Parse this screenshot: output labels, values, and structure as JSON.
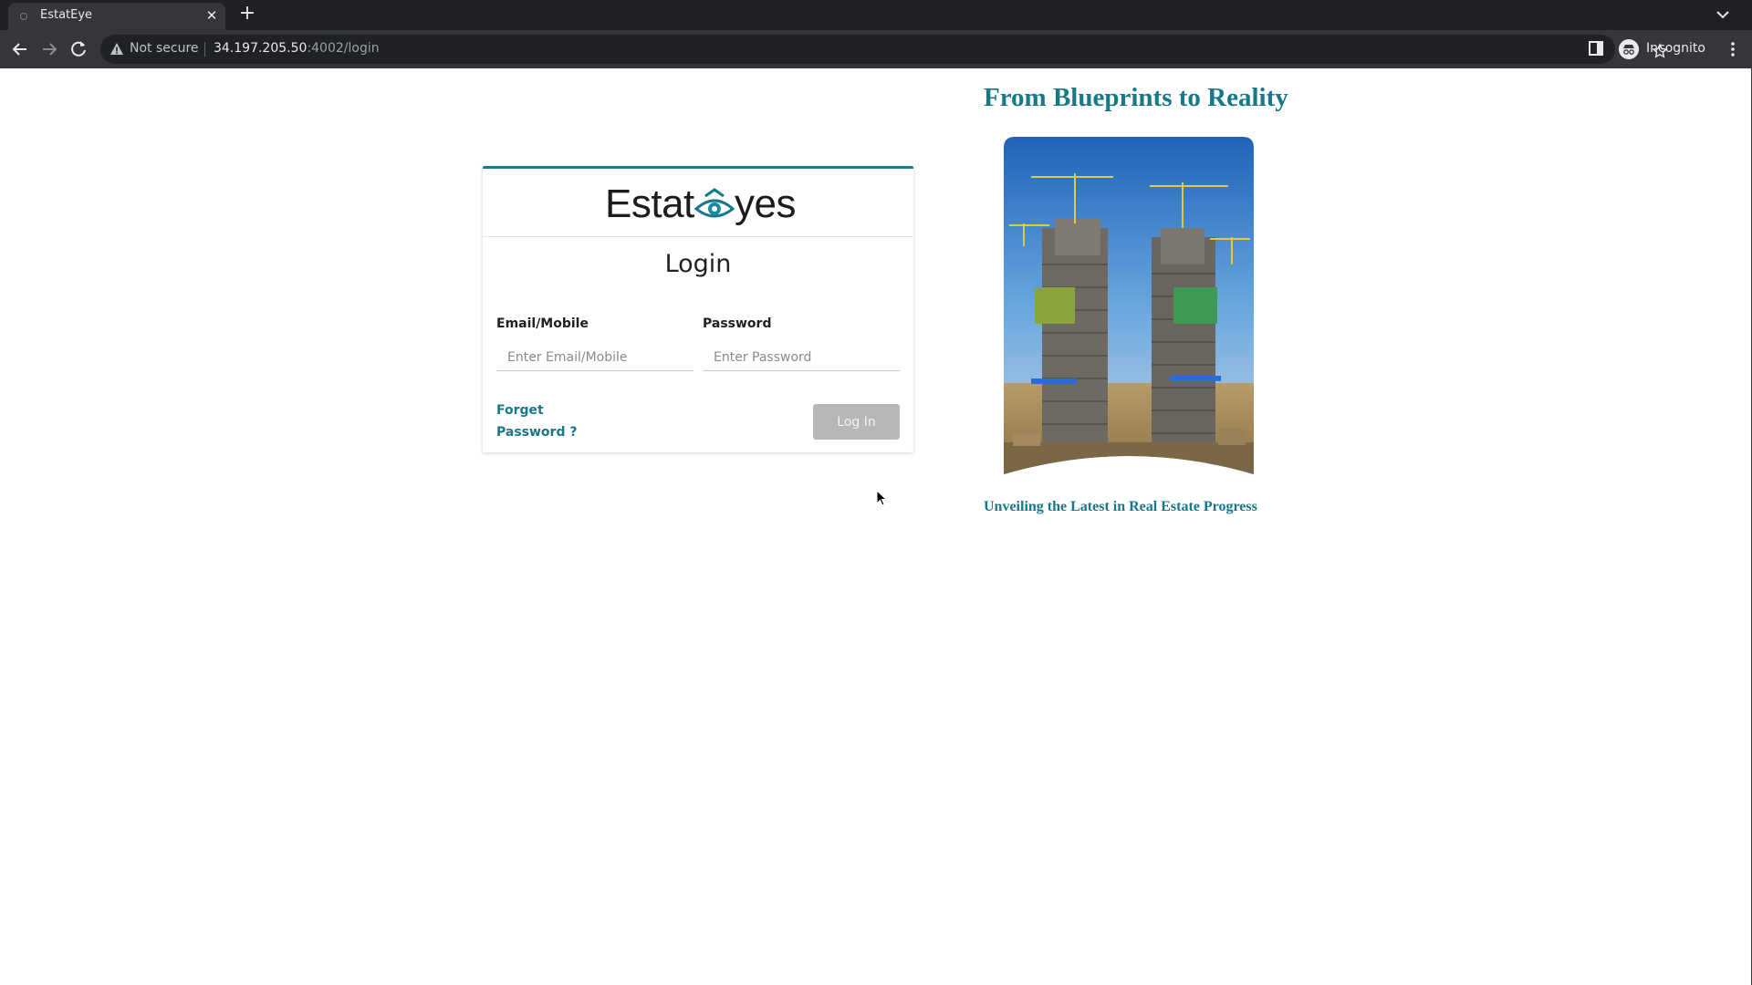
{
  "browser": {
    "tab_title": "EstatEye",
    "security_label": "Not secure",
    "url_host": "34.197.205.50",
    "url_path": ":4002/login",
    "profile_label": "Incognito"
  },
  "login": {
    "logo_prefix": "Estat",
    "logo_suffix": "yes",
    "title": "Login",
    "email_label": "Email/Mobile",
    "email_placeholder": "Enter Email/Mobile",
    "password_label": "Password",
    "password_placeholder": "Enter Password",
    "forgot_line1": "Forget",
    "forgot_line2": "Password ?",
    "submit_label": "Log In"
  },
  "promo": {
    "title": "From Blueprints to Reality",
    "caption": "Unveiling the Latest in Real Estate Progress"
  },
  "colors": {
    "accent": "#17788a",
    "button_disabled": "#b7b7b7",
    "chrome_dark": "#1f2023",
    "chrome_toolbar": "#35363a"
  },
  "icons": [
    "back-icon",
    "forward-icon",
    "reload-icon",
    "warning-icon",
    "star-icon",
    "side-panel-icon",
    "incognito-icon",
    "menu-icon",
    "eye-logo-icon",
    "close-icon",
    "plus-icon"
  ]
}
